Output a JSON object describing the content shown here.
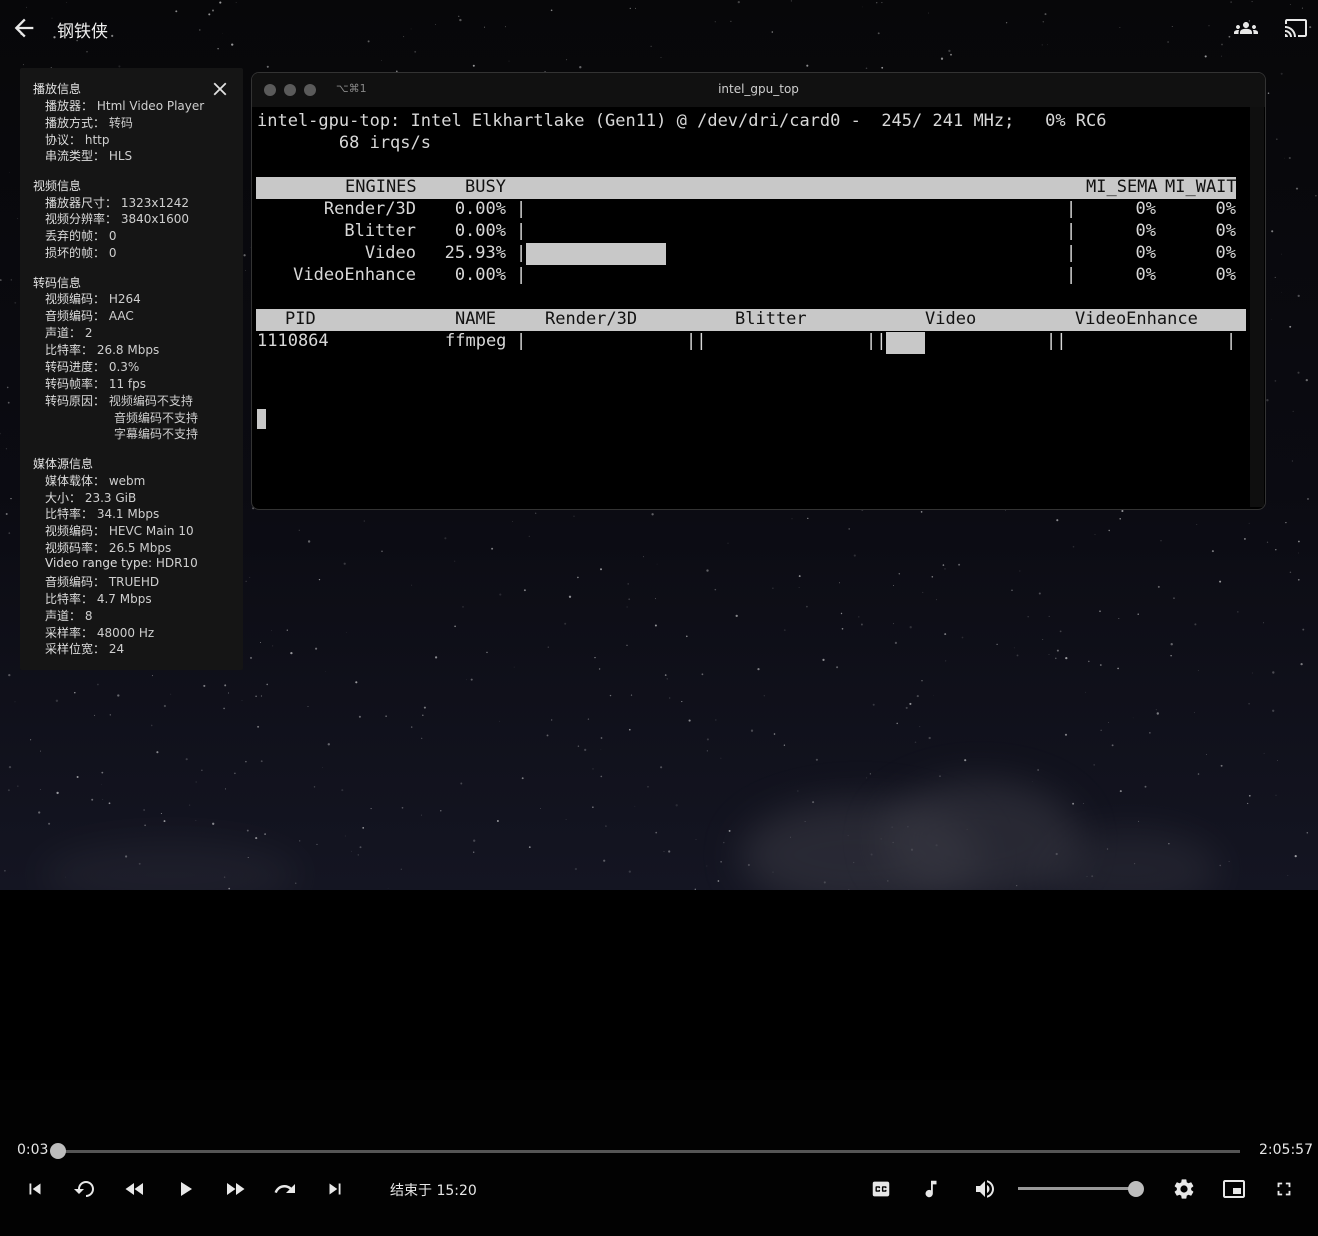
{
  "header": {
    "title": "钢铁侠",
    "back_icon": "arrow-left-icon",
    "group_icon": "people-icon",
    "cast_icon": "cast-icon"
  },
  "info_panel": {
    "close_icon": "close-icon",
    "playback": {
      "heading": "播放信息",
      "rows": [
        {
          "k": "播放器：",
          "v": "Html Video Player"
        },
        {
          "k": "播放方式：",
          "v": "转码"
        },
        {
          "k": "协议：",
          "v": "http"
        },
        {
          "k": "串流类型：",
          "v": "HLS"
        }
      ]
    },
    "video": {
      "heading": "视频信息",
      "rows": [
        {
          "k": "播放器尺寸：",
          "v": "1323x1242"
        },
        {
          "k": "视频分辨率：",
          "v": "3840x1600"
        },
        {
          "k": "丢弃的帧：",
          "v": "0"
        },
        {
          "k": "损坏的帧：",
          "v": "0"
        }
      ]
    },
    "transcode": {
      "heading": "转码信息",
      "rows": [
        {
          "k": "视频编码：",
          "v": "H264"
        },
        {
          "k": "音频编码：",
          "v": "AAC"
        },
        {
          "k": "声道：",
          "v": "2"
        },
        {
          "k": "比特率：",
          "v": "26.8 Mbps"
        },
        {
          "k": "转码进度：",
          "v": "0.3%"
        },
        {
          "k": "转码帧率：",
          "v": "11 fps"
        },
        {
          "k": "转码原因：",
          "v": "视频编码不支持"
        }
      ],
      "extra_reasons": [
        "音频编码不支持",
        "字幕编码不支持"
      ]
    },
    "source": {
      "heading": "媒体源信息",
      "rows": [
        {
          "k": "媒体载体：",
          "v": "webm"
        },
        {
          "k": "大小：",
          "v": "23.3 GiB"
        },
        {
          "k": "比特率：",
          "v": "34.1 Mbps"
        },
        {
          "k": "视频编码：",
          "v": "HEVC Main 10"
        },
        {
          "k": "视频码率：",
          "v": "26.5 Mbps"
        },
        {
          "k": "Video range type:",
          "v": "HDR10"
        },
        {
          "k": "音频编码：",
          "v": "TRUEHD"
        },
        {
          "k": "比特率：",
          "v": "4.7 Mbps"
        },
        {
          "k": "声道：",
          "v": "8"
        },
        {
          "k": "采样率：",
          "v": "48000 Hz"
        },
        {
          "k": "采样位宽：",
          "v": "24"
        }
      ]
    }
  },
  "terminal": {
    "shortcut": "⌥⌘1",
    "title": "intel_gpu_top",
    "line1": "intel-gpu-top: Intel Elkhartlake (Gen11) @ /dev/dri/card0 -  245/ 241 MHz;   0% RC6",
    "line2": "        68 irqs/s",
    "engines_header": {
      "engines": "ENGINES",
      "busy": "BUSY",
      "mi_sema": "MI_SEMA",
      "mi_wait": "MI_WAIT"
    },
    "engines": [
      {
        "name": "Render/3D",
        "busy": "0.00%",
        "busy_fraction": 0.0,
        "sema": "0%",
        "wait": "0%"
      },
      {
        "name": "Blitter",
        "busy": "0.00%",
        "busy_fraction": 0.0,
        "sema": "0%",
        "wait": "0%"
      },
      {
        "name": "Video",
        "busy": "25.93%",
        "busy_fraction": 0.2593,
        "sema": "0%",
        "wait": "0%"
      },
      {
        "name": "VideoEnhance",
        "busy": "0.00%",
        "busy_fraction": 0.0,
        "sema": "0%",
        "wait": "0%"
      }
    ],
    "proc_header": {
      "pid": "PID",
      "name": "NAME",
      "render": "Render/3D",
      "blitter": "Blitter",
      "video": "Video",
      "enhance": "VideoEnhance"
    },
    "proc": {
      "pid": "1110864",
      "name": "ffmpeg"
    }
  },
  "player": {
    "current_time": "0:03",
    "duration": "2:05:57",
    "progress_fraction": 0.0004,
    "end_time_label": "结束于 15:20",
    "volume_fraction": 1.0,
    "icons": [
      "skip-previous-icon",
      "replay-icon",
      "rewind-icon",
      "play-icon",
      "fast-forward-icon",
      "forward-icon",
      "skip-next-icon",
      "subtitles-icon",
      "audio-track-icon",
      "volume-icon",
      "settings-icon",
      "picture-in-picture-icon",
      "fullscreen-icon"
    ]
  }
}
